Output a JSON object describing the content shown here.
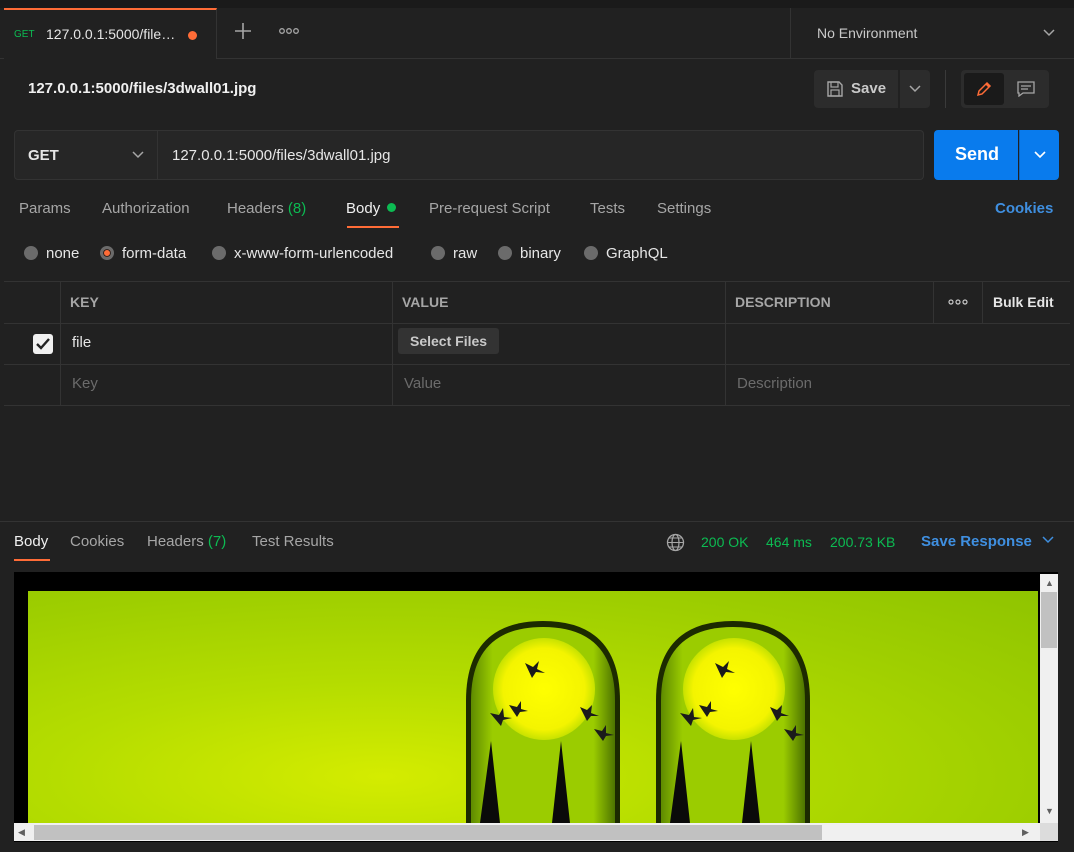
{
  "tab": {
    "method": "GET",
    "title": "127.0.0.1:5000/file…"
  },
  "environment": {
    "label": "No Environment"
  },
  "request": {
    "title": "127.0.0.1:5000/files/3dwall01.jpg",
    "save_label": "Save",
    "method": "GET",
    "url": "127.0.0.1:5000/files/3dwall01.jpg",
    "send_label": "Send"
  },
  "req_tabs": {
    "params": "Params",
    "authorization": "Authorization",
    "headers": "Headers",
    "headers_count": "(8)",
    "body": "Body",
    "prerequest": "Pre-request Script",
    "tests": "Tests",
    "settings": "Settings",
    "cookies": "Cookies"
  },
  "body_types": {
    "none": "none",
    "form_data": "form-data",
    "urlencoded": "x-www-form-urlencoded",
    "raw": "raw",
    "binary": "binary",
    "graphql": "GraphQL",
    "selected": "form-data"
  },
  "table": {
    "headers": {
      "key": "KEY",
      "value": "VALUE",
      "description": "DESCRIPTION",
      "bulk_edit": "Bulk Edit"
    },
    "rows": [
      {
        "checked": true,
        "key": "file",
        "value_button": "Select Files"
      }
    ],
    "placeholders": {
      "key": "Key",
      "value": "Value",
      "description": "Description"
    }
  },
  "response": {
    "tabs": {
      "body": "Body",
      "cookies": "Cookies",
      "headers": "Headers",
      "headers_count": "(7)",
      "test_results": "Test Results"
    },
    "status": "200 OK",
    "time": "464 ms",
    "size": "200.73 KB",
    "save_response": "Save Response"
  },
  "colors": {
    "accent": "#ff6c37",
    "send": "#097bed",
    "success": "#0cbb52",
    "link": "#3f8fe0"
  }
}
